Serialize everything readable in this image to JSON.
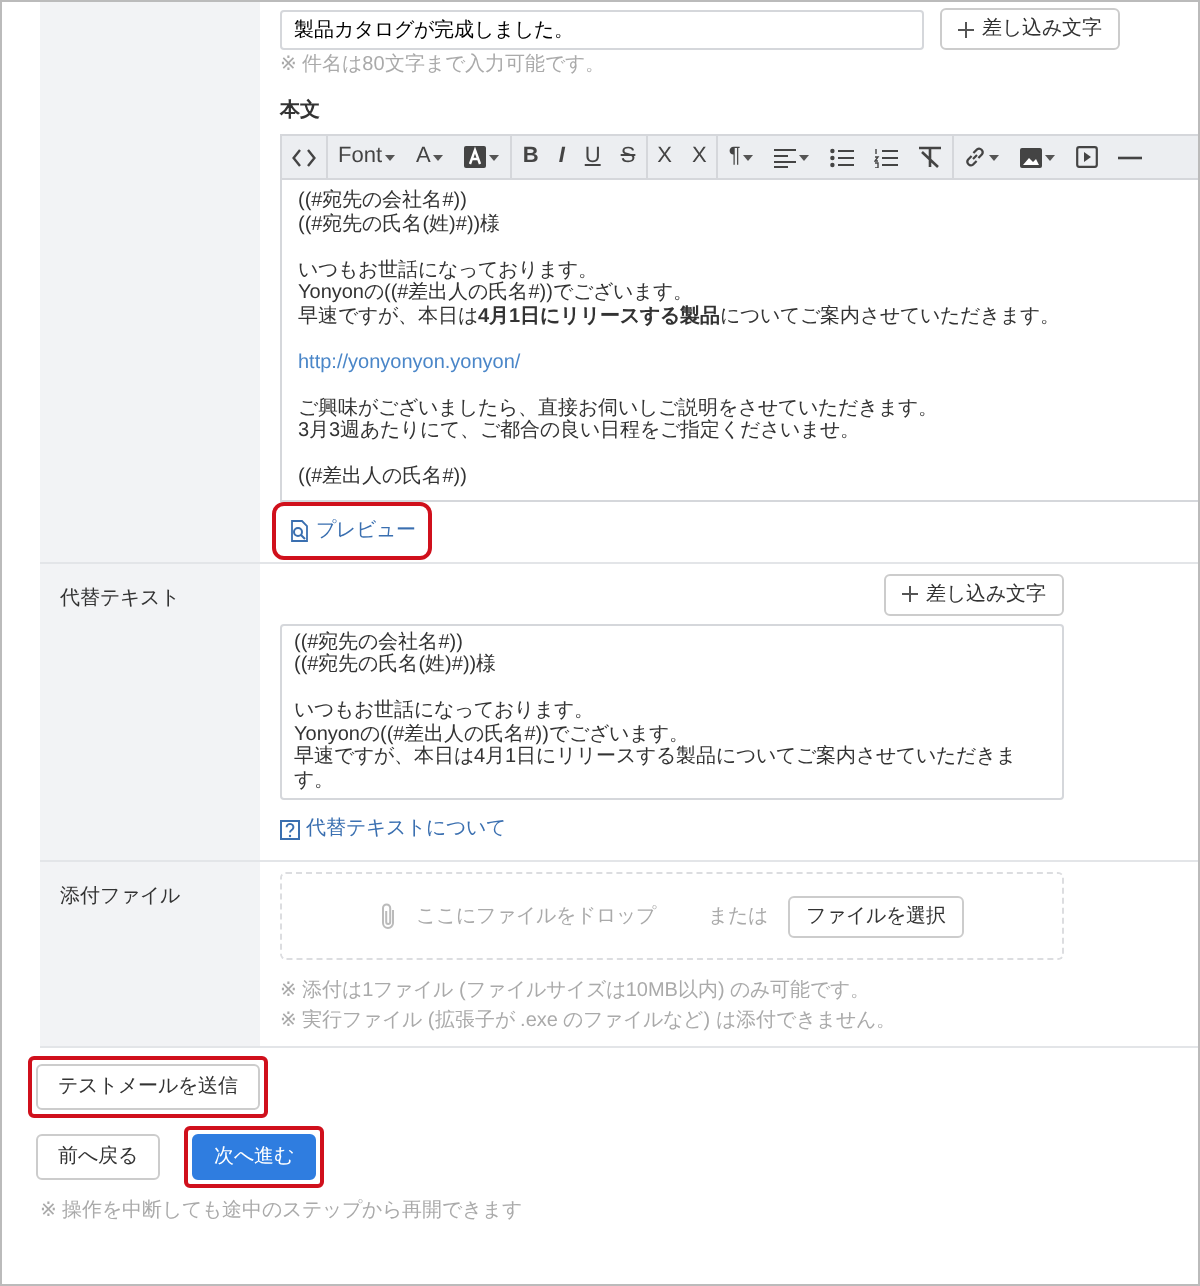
{
  "subject": {
    "value": "製品カタログが完成しました。",
    "insert_button": "差し込み文字",
    "hint": "※ 件名は80文字まで入力可能です。"
  },
  "body": {
    "label": "本文",
    "toolbar": [
      {
        "kind": "icon",
        "dropdown": false
      },
      {
        "kind": "text",
        "label": "Font",
        "dropdown": true
      },
      {
        "kind": "text",
        "label": "A",
        "dropdown": true
      },
      {
        "kind": "icon",
        "dropdown": true
      },
      {
        "kind": "text",
        "label": "B",
        "dropdown": false
      },
      {
        "kind": "text",
        "label": "I",
        "dropdown": false
      },
      {
        "kind": "text",
        "label": "U",
        "dropdown": false
      },
      {
        "kind": "text",
        "label": "S",
        "dropdown": false
      },
      {
        "kind": "text",
        "label": "X",
        "dropdown": false
      },
      {
        "kind": "text",
        "label": "X",
        "dropdown": false
      },
      {
        "kind": "text",
        "label": "¶",
        "dropdown": true
      },
      {
        "kind": "icon",
        "dropdown": true
      },
      {
        "kind": "icon",
        "dropdown": false
      },
      {
        "kind": "icon",
        "dropdown": false
      },
      {
        "kind": "icon",
        "dropdown": false
      },
      {
        "kind": "icon",
        "dropdown": true
      },
      {
        "kind": "icon",
        "dropdown": true
      },
      {
        "kind": "icon",
        "dropdown": false
      },
      {
        "kind": "icon",
        "dropdown": false
      }
    ],
    "lines": [
      {
        "kind": "text",
        "text": "((#宛先の会社名#))"
      },
      {
        "kind": "text",
        "text": "((#宛先の氏名(姓)#))様"
      },
      {
        "kind": "blank"
      },
      {
        "kind": "text",
        "text": "いつもお世話になっております。"
      },
      {
        "kind": "text",
        "text": "Yonyonの((#差出人の氏名#))でございます。"
      },
      {
        "kind": "text",
        "text": "早速ですが、本日は**4月1日にリリースする製品**についてご案内させていただきます。"
      },
      {
        "kind": "blank"
      },
      {
        "kind": "link",
        "text": "http://yonyonyon.yonyon/"
      },
      {
        "kind": "blank"
      },
      {
        "kind": "text",
        "text": "ご興味がございましたら、直接お伺いしご説明をさせていただきます。"
      },
      {
        "kind": "text",
        "text": "3月3週あたりにて、ご都合の良い日程をご指定くださいませ。"
      },
      {
        "kind": "blank"
      },
      {
        "kind": "text",
        "text": "((#差出人の氏名#))"
      }
    ],
    "preview_link": {
      "label": "プレビュー",
      "highlighted": true
    }
  },
  "alt_text": {
    "label": "代替テキスト",
    "insert_button": "差し込み文字",
    "paragraphs": [
      [
        "((#宛先の会社名#))",
        "((#宛先の氏名(姓)#))様"
      ],
      [
        "いつもお世話になっております。",
        "Yonyonの((#差出人の氏名#))でございます。",
        "早速ですが、本日は4月1日にリリースする製品についてご案内させていただきます。"
      ]
    ],
    "help_link": "代替テキストについて"
  },
  "attachment": {
    "label": "添付ファイル",
    "drop_text": "ここにファイルをドロップ",
    "or_text": "または",
    "select_button": "ファイルを選択",
    "notes": [
      "※ 添付は1ファイル (ファイルサイズは10MB以内) のみ可能です。",
      "※ 実行ファイル (拡張子が .exe のファイルなど) は添付できません。"
    ]
  },
  "test_button": {
    "label": "テストメールを送信",
    "highlighted": true
  },
  "nav_buttons": [
    {
      "label": "前へ戻る",
      "kind": "secondary",
      "highlighted": false
    },
    {
      "label": "次へ進む",
      "kind": "primary",
      "highlighted": true
    }
  ],
  "footer_note": "※ 操作を中断しても途中のステップから再開できます"
}
